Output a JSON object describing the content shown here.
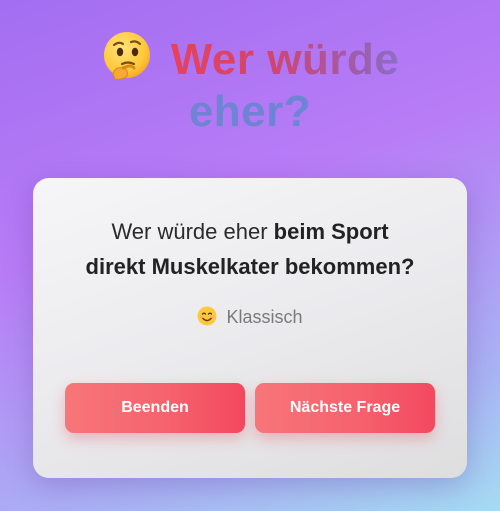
{
  "header": {
    "emoji_icon": "thinking-face-icon",
    "title_line1": "Wer würde",
    "title_line2": "eher?"
  },
  "card": {
    "question_prefix": "Wer würde eher ",
    "question_bold_line1": "beim Sport",
    "question_bold_line2": "direkt Muskelkater bekommen?",
    "category_icon": "smiling-face-icon",
    "category_label": "Klassisch"
  },
  "buttons": {
    "end_label": "Beenden",
    "next_label": "Nächste Frage"
  },
  "colors": {
    "button_gradient_start": "#f77679",
    "button_gradient_end": "#f3485f",
    "title_red": "#e7425f",
    "title_blue": "#6c85d4"
  }
}
